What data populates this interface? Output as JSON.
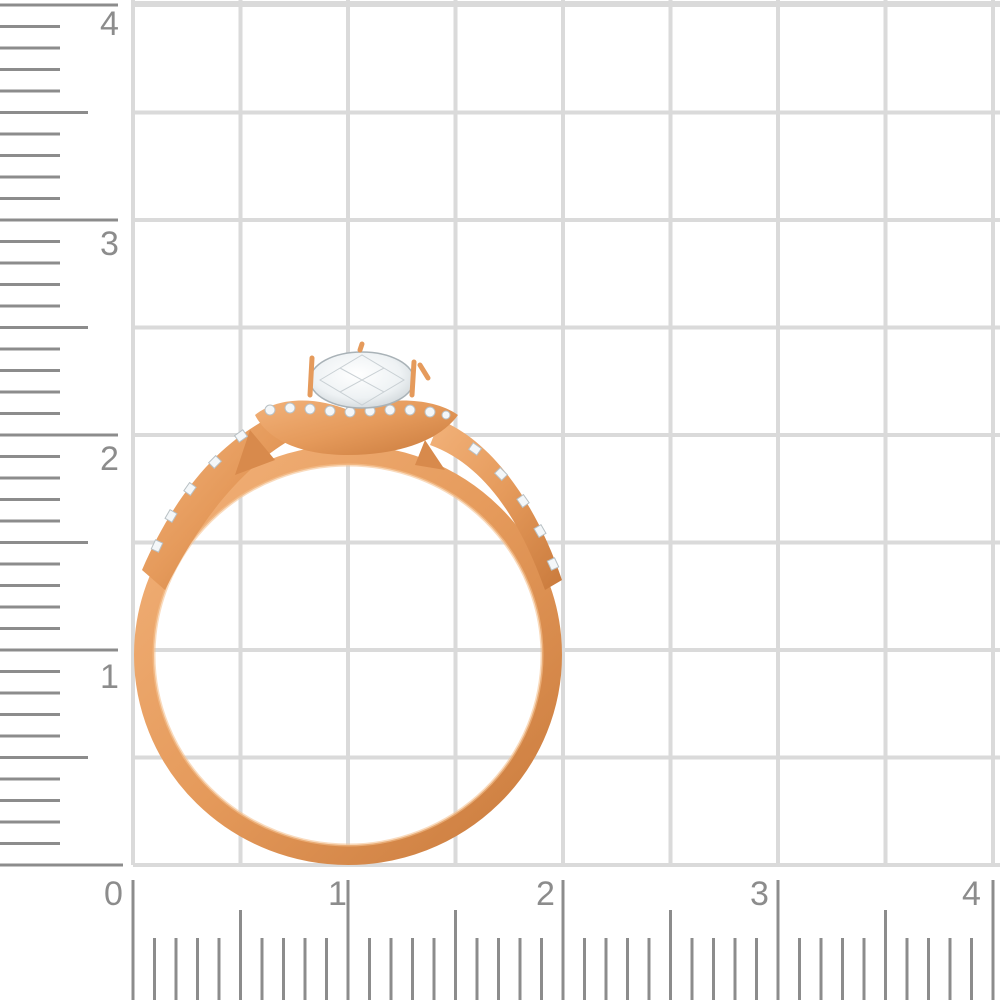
{
  "ruler": {
    "unit_labels_y": [
      "1",
      "2",
      "3",
      "4"
    ],
    "unit_labels_x": [
      "0",
      "1",
      "2",
      "3",
      "4"
    ],
    "ticks_per_unit": 5,
    "grid_divisions_per_unit": 2
  },
  "ring": {
    "metal_color": "#E59A5B",
    "stone_color": "#F4F7F9",
    "grid_color": "#DADADA",
    "ruler_color": "#8C8C8C"
  }
}
